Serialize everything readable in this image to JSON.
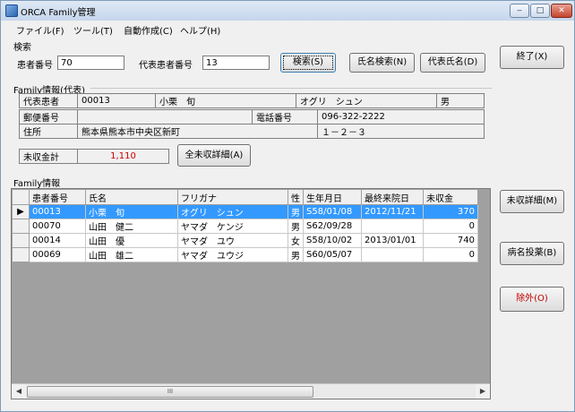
{
  "window": {
    "title": "ORCA Family管理",
    "minimize": "‒",
    "maximize": "□",
    "close": "✕"
  },
  "menu": [
    "ファイル(F)",
    "ツール(T)",
    "自動作成(C)",
    "ヘルプ(H)"
  ],
  "search": {
    "group_label": "検索",
    "patient_no_label": "患者番号",
    "patient_no_value": "70",
    "rep_patient_no_label": "代表患者番号",
    "rep_patient_no_value": "13",
    "search_button": "検索(S)",
    "name_search_button": "氏名検索(N)",
    "rep_name_button": "代表氏名(D)",
    "exit_button": "終了(X)"
  },
  "family_info": {
    "group_label": "Family情報(代表)",
    "rep_label": "代表患者",
    "rep_id": "00013",
    "rep_name": "小栗　旬",
    "rep_kana": "オグリ　シュン",
    "rep_sex": "男",
    "postal_label": "郵便番号",
    "postal_value": "",
    "phone_label": "電話番号",
    "phone_value": "096-322-2222",
    "address_label": "住所",
    "address1": "熊本県熊本市中央区新町",
    "address2": "１－２－３",
    "unpaid_total_label": "未収金計",
    "unpaid_total_value": "1,110",
    "all_unpaid_button": "全未収詳細(A)"
  },
  "family_list": {
    "group_label": "Family情報",
    "columns": [
      "患者番号",
      "氏名",
      "フリガナ",
      "性",
      "生年月日",
      "最終来院日",
      "未収金"
    ],
    "rows": [
      {
        "id": "00013",
        "name": "小栗　旬",
        "kana": "オグリ　シュン",
        "sex": "男",
        "dob": "S58/01/08",
        "last_visit": "2012/11/21",
        "unpaid": "370",
        "selected": true
      },
      {
        "id": "00070",
        "name": "山田　健二",
        "kana": "ヤマダ　ケンジ",
        "sex": "男",
        "dob": "S62/09/28",
        "last_visit": "",
        "unpaid": "0",
        "selected": false
      },
      {
        "id": "00014",
        "name": "山田　優",
        "kana": "ヤマダ　ユウ",
        "sex": "女",
        "dob": "S58/10/02",
        "last_visit": "2013/01/01",
        "unpaid": "740",
        "selected": false
      },
      {
        "id": "00069",
        "name": "山田　雄二",
        "kana": "ヤマダ　ユウジ",
        "sex": "男",
        "dob": "S60/05/07",
        "last_visit": "",
        "unpaid": "0",
        "selected": false
      }
    ],
    "current_row_marker": "▶",
    "scroll_grip": "III"
  },
  "side_buttons": {
    "unpaid_detail": "未収詳細(M)",
    "disease_prescription": "病名投薬(B)",
    "exclude": "除外(O)"
  },
  "colors": {
    "selection": "#3399ff",
    "unpaid_total": "#cc0000",
    "exclude_text": "#c00000"
  }
}
